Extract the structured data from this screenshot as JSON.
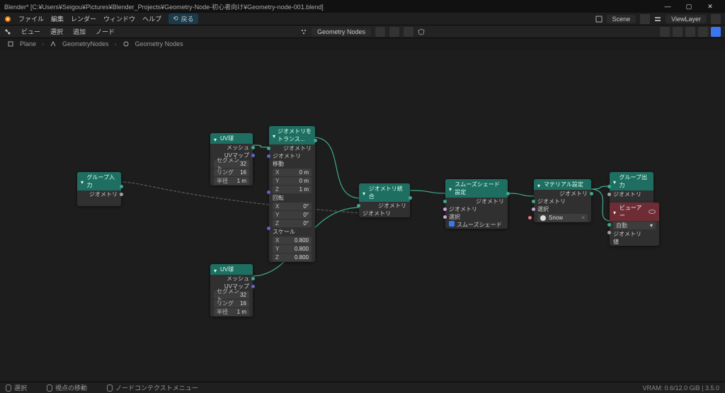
{
  "app_title": "Blender* [C:¥Users¥Seigou¥Pictures¥Blender_Projects¥Geometry-Node-初心者向け¥Geometry-node-001.blend]",
  "menu": {
    "icon": "blender",
    "file": "ファイル",
    "edit": "編集",
    "render": "レンダー",
    "window": "ウィンドウ",
    "help": "ヘルプ",
    "goback": "戻る"
  },
  "header_right": {
    "scene_icon": "scene-icon",
    "scene": "Scene",
    "viewlayers_icon": "viewlayers-icon",
    "viewlayers": "ViewLayer"
  },
  "toolbar": {
    "view": "ビュー",
    "select": "選択",
    "add": "追加",
    "node": "ノード",
    "center_label": "Geometry Nodes",
    "pin_icon": "pin-icon",
    "shield_icon": "shield-icon"
  },
  "breadcrumb": {
    "i0": "Plane",
    "i1": "GeometryNodes",
    "i2": "Geometry Nodes"
  },
  "nodes": {
    "group_input": {
      "title": "グループ入力",
      "out_geo": "ジオメトリ"
    },
    "uv1": {
      "title": "UV球",
      "out_mesh": "メッシュ",
      "out_uv": "UVマップ",
      "seg_lbl": "セグメント",
      "seg_val": "32",
      "ring_lbl": "リング",
      "ring_val": "16",
      "rad_lbl": "半径",
      "rad_val": "1 m"
    },
    "uv2": {
      "title": "UV球",
      "out_mesh": "メッシュ",
      "out_uv": "UVマップ",
      "seg_lbl": "セグメント",
      "seg_val": "32",
      "ring_lbl": "リング",
      "ring_val": "16",
      "rad_lbl": "半径",
      "rad_val": "1 m"
    },
    "transform": {
      "title": "ジオメトリをトランス...",
      "out_geo": "ジオメトリ",
      "in_geo": "ジオメトリ",
      "sec_trans": "移動",
      "tx_lbl": "X",
      "tx_val": "0 m",
      "ty_lbl": "Y",
      "ty_val": "0 m",
      "tz_lbl": "Z",
      "tz_val": "1 m",
      "sec_rot": "回転",
      "rx_lbl": "X",
      "rx_val": "0°",
      "ry_lbl": "Y",
      "ry_val": "0°",
      "rz_lbl": "Z",
      "rz_val": "0°",
      "sec_scale": "スケール",
      "sx_lbl": "X",
      "sx_val": "0.800",
      "sy_lbl": "Y",
      "sy_val": "0.800",
      "sz_lbl": "Z",
      "sz_val": "0.800"
    },
    "join": {
      "title": "ジオメトリ統合",
      "out_geo": "ジオメトリ",
      "in_geo": "ジオメトリ"
    },
    "smooth": {
      "title": "スムーズシェード設定",
      "out_geo": "ジオメトリ",
      "in_geo": "ジオメトリ",
      "in_sel": "選択",
      "in_smooth": "スムーズシェード"
    },
    "material": {
      "title": "マテリアル設定",
      "out_geo": "ジオメトリ",
      "in_geo": "ジオメトリ",
      "in_sel": "選択",
      "mat_val": "Snow"
    },
    "group_output": {
      "title": "グループ出力",
      "in_geo": "ジオメトリ"
    },
    "viewer": {
      "title": "ビューアー",
      "auto": "自動",
      "in_geo": "ジオメトリ",
      "in_val": "値"
    }
  },
  "status": {
    "s0": "選択",
    "s1": "視点の移動",
    "s2": "ノードコンテクストメニュー",
    "vram": "VRAM: 0.6/12.0 GiB | 3.5.0"
  }
}
